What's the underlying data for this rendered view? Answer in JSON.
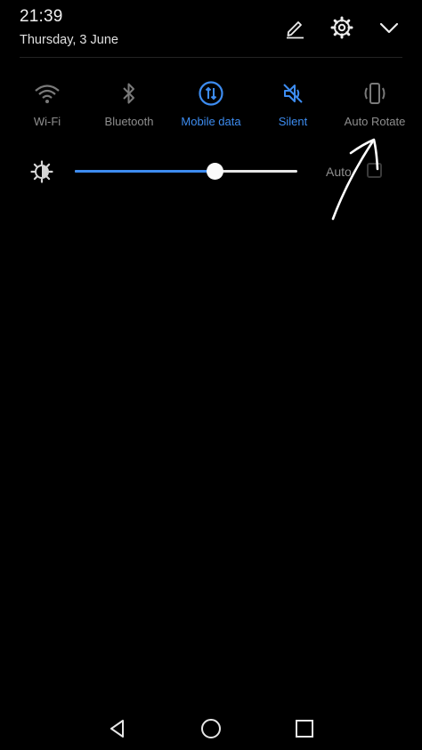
{
  "header": {
    "time": "21:39",
    "date": "Thursday, 3 June"
  },
  "icons": {
    "edit": "pencil-icon",
    "settings": "gear-icon",
    "collapse": "chevron-down-icon"
  },
  "tiles": [
    {
      "label": "Wi-Fi",
      "icon": "wifi-icon",
      "active": false
    },
    {
      "label": "Bluetooth",
      "icon": "bluetooth-icon",
      "active": false
    },
    {
      "label": "Mobile data",
      "icon": "mobile-data-icon",
      "active": true
    },
    {
      "label": "Silent",
      "icon": "silent-icon",
      "active": true
    },
    {
      "label": "Auto Rotate",
      "icon": "auto-rotate-icon",
      "active": false
    }
  ],
  "brightness": {
    "level": 0.63,
    "auto_label": "Auto",
    "auto_checked": false
  },
  "nav": {
    "back": "back-triangle-icon",
    "home": "home-circle-icon",
    "recents": "recents-square-icon"
  },
  "colors": {
    "background": "#000000",
    "accent": "#3d8cf0",
    "inactive": "#8e8e8e",
    "text": "#e8e8e8"
  }
}
